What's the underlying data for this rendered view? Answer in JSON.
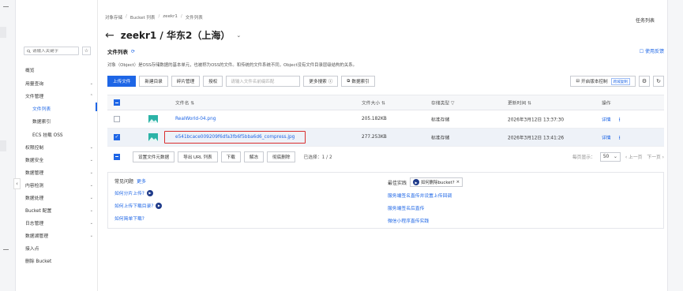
{
  "breadcrumb": [
    "对象存储",
    "Bucket 列表",
    "zeekr1",
    "文件列表"
  ],
  "task_list": "任务列表",
  "title": "zeekr1 / 华东2（上海）",
  "sidebar": {
    "search_placeholder": "请输入关键字",
    "items": [
      {
        "label": "概览",
        "chevron": false
      },
      {
        "label": "用量查询",
        "chevron": true
      },
      {
        "label": "文件管理",
        "chevron": true
      },
      {
        "label": "权限控制",
        "chevron": true
      },
      {
        "label": "数据安全",
        "chevron": true
      },
      {
        "label": "数据管理",
        "chevron": true
      },
      {
        "label": "内容检测",
        "chevron": true
      },
      {
        "label": "数据处理",
        "chevron": true
      },
      {
        "label": "Bucket 配置",
        "chevron": true
      },
      {
        "label": "日志管理",
        "chevron": true
      },
      {
        "label": "数据湖管理",
        "chevron": true
      },
      {
        "label": "接入点",
        "chevron": false
      },
      {
        "label": "删除 Bucket",
        "chevron": false
      }
    ],
    "sub_items": [
      {
        "label": "文件列表",
        "active": true
      },
      {
        "label": "数据索引",
        "active": false
      },
      {
        "label": "ECS 挂载 OSS",
        "active": false
      }
    ]
  },
  "section": {
    "title": "文件列表",
    "usage_guide": "使用反馈",
    "description": "对象（Object）是OSS存储数据的基本单元，也被称为OSS的文件。和传统的文件系统不同，Object没有文件目录层级结构的关系。"
  },
  "toolbar": {
    "upload": "上传文件",
    "new_dir": "新建目录",
    "fragments": "碎片管理",
    "authorize": "授权",
    "search_placeholder": "请输入文件名前缀匹配",
    "more_search": "更多搜索",
    "data_index": "数据索引",
    "version_control": "开启版本控制",
    "version_badge": "跨域复制"
  },
  "table": {
    "headers": {
      "name": "文件名",
      "size": "文件大小",
      "storage": "存储类型",
      "updated": "更新时间",
      "actions": "操作"
    },
    "rows": [
      {
        "name": "RealWorld-04.png",
        "size": "205.182KB",
        "storage": "标准存储",
        "updated": "2026年3月12日 13:37:30",
        "detail": "详情",
        "checked": false
      },
      {
        "name": "e541bcace009209f6dfa3fb6f5bba6d6_compress.jpg",
        "size": "277.253KB",
        "storage": "标准存储",
        "updated": "2026年3月12日 13:41:26",
        "detail": "详情",
        "checked": true
      }
    ]
  },
  "batch": {
    "set_storage": "设置文件元数据",
    "export_url": "导出 URL 列表",
    "download": "下载",
    "unfreeze": "解冻",
    "delete": "彻底删除",
    "selected": "已选择：1 / 2"
  },
  "pager": {
    "per_page_label": "每页显示：",
    "per_page": "50",
    "prev": "上一页",
    "next": "下一页"
  },
  "help": {
    "faq_title": "常见问题",
    "faq_more": "更多",
    "faq_links": [
      "如何分片上传?",
      "如何上传下载目录?",
      "如何简单下载?"
    ],
    "best_title": "最佳实践",
    "best_tag": "如何删除bucket?",
    "best_links": [
      "服务端签名直传并设置上传回调",
      "服务端签名后直传",
      "微信小程序直传实践"
    ]
  }
}
